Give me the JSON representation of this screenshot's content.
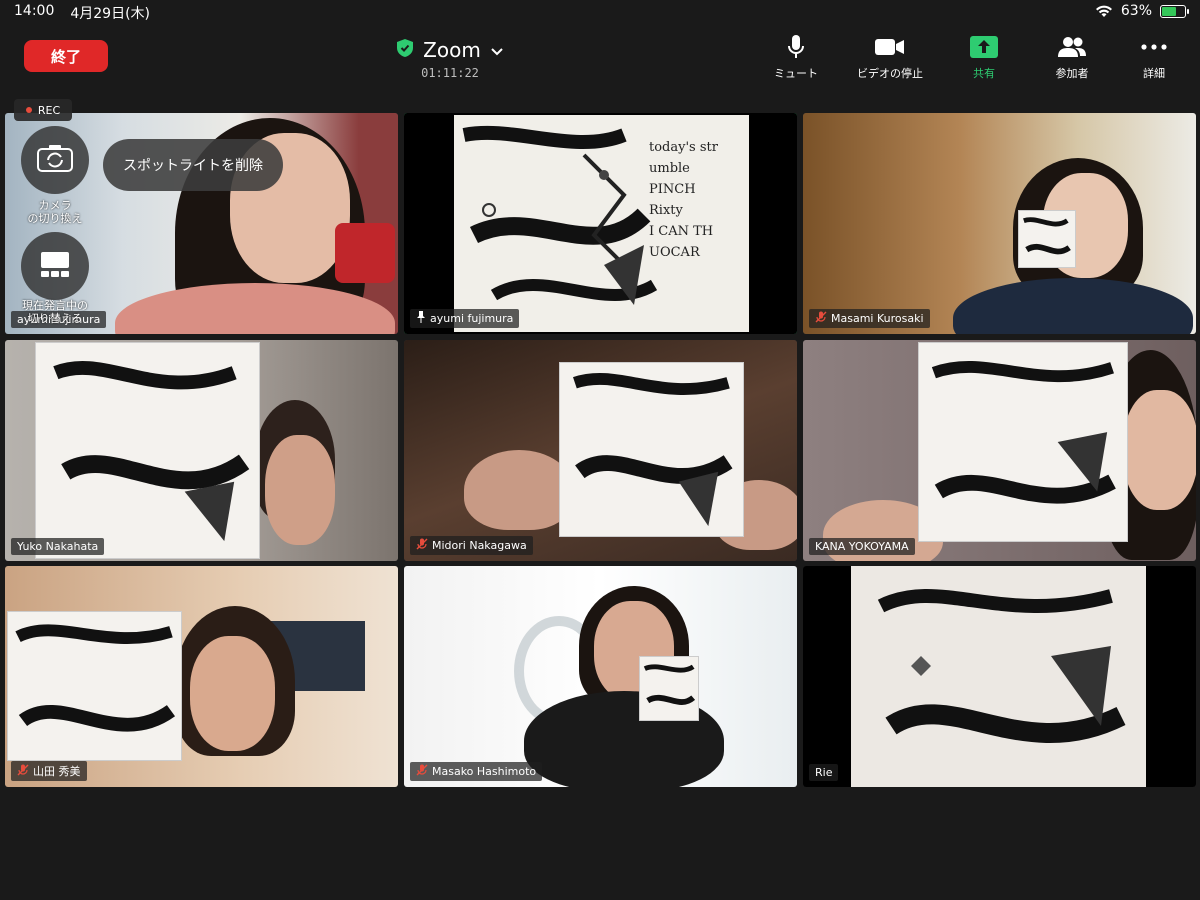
{
  "status_bar": {
    "time": "14:00",
    "date": "4月29日(木)",
    "battery_percent": "63%",
    "battery_level": 0.63
  },
  "header": {
    "end_button_label": "終了",
    "title": "Zoom",
    "elapsed": "01:11:22"
  },
  "toolbar": {
    "mute_label": "ミュート",
    "stop_video_label": "ビデオの停止",
    "share_label": "共有",
    "participants_label": "参加者",
    "more_label": "詳細"
  },
  "overlay": {
    "rec_label": "REC",
    "switch_camera_label": "カメラ\nの切り換え",
    "spotlight_remove_label": "スポットライトを削除",
    "switch_speaker_label": "現在発言中の\n切り替える"
  },
  "participants": [
    {
      "name": "ayumi fujimura",
      "muted": false,
      "pinned": false
    },
    {
      "name": "ayumi fujimura",
      "muted": false,
      "pinned": true,
      "active_speaker": true
    },
    {
      "name": "Masami Kurosaki",
      "muted": true
    },
    {
      "name": "Yuko Nakahata",
      "muted": false
    },
    {
      "name": "Midori Nakagawa",
      "muted": true
    },
    {
      "name": "KANA YOKOYAMA",
      "muted": false
    },
    {
      "name": "山田 秀美",
      "muted": true
    },
    {
      "name": "Masako Hashimoto",
      "muted": true
    },
    {
      "name": "Rie",
      "muted": false
    }
  ],
  "whiteboard_text": [
    "today's str",
    "umble",
    "PINCH",
    "Rixty",
    "I CAN TH",
    "UOCAR"
  ],
  "colors": {
    "end_red": "#e02828",
    "share_green": "#2ecc71",
    "shield_green": "#2ecc71",
    "mute_red": "#e74c3c",
    "battery_green": "#34c759"
  }
}
